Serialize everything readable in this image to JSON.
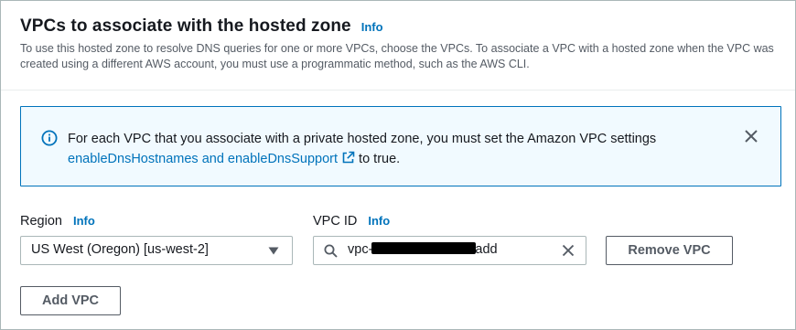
{
  "section": {
    "title": "VPCs to associate with the hosted zone",
    "info_label": "Info",
    "description": "To use this hosted zone to resolve DNS queries for one or more VPCs, choose the VPCs. To associate a VPC with a hosted zone when the VPC was created using a different AWS account, you must use a programmatic method, such as the AWS CLI."
  },
  "alert": {
    "icon": "info-circle-icon",
    "text": "For each VPC that you associate with a private hosted zone, you must set the Amazon VPC settings ",
    "link_text": "enableDnsHostnames and enableDnsSupport",
    "text_after": " to true.",
    "close_icon": "close-icon"
  },
  "region": {
    "label": "Region",
    "info_label": "Info",
    "selected_value": "US West (Oregon) [us-west-2]"
  },
  "vpc": {
    "label": "VPC ID",
    "info_label": "Info",
    "value_prefix": "vpc-",
    "value_suffix": "add"
  },
  "buttons": {
    "remove_vpc": "Remove VPC",
    "add_vpc": "Add VPC"
  },
  "colors": {
    "link": "#0073bb",
    "alert_background": "#f1faff",
    "alert_border": "#0073bb",
    "text": "#16191f",
    "secondary_text": "#545b64"
  }
}
